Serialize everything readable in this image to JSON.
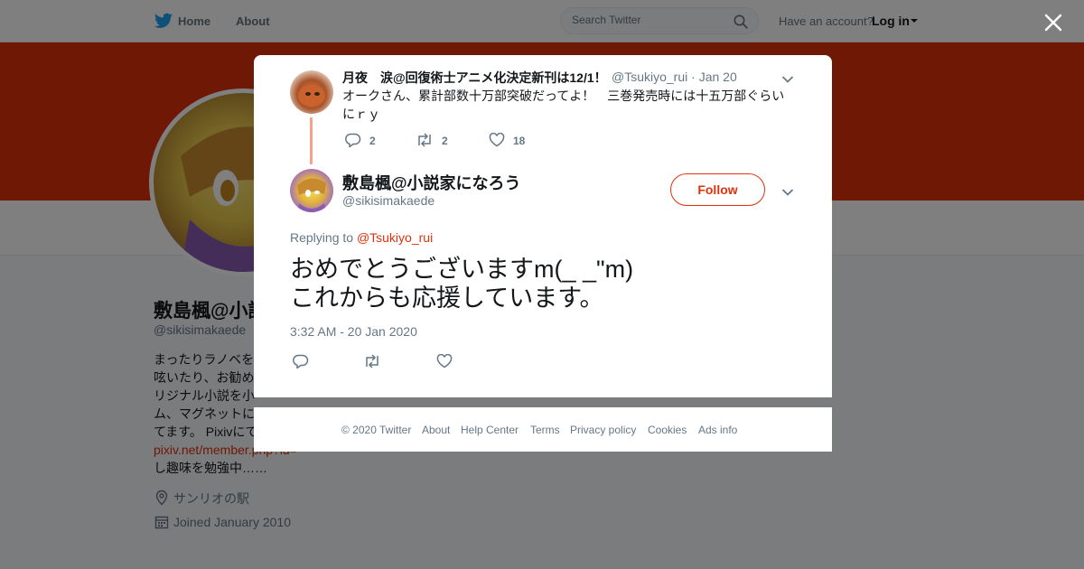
{
  "nav": {
    "home": "Home",
    "about": "About",
    "search_placeholder": "Search Twitter",
    "account_prompt": "Have an account?",
    "login": "Log in"
  },
  "profile": {
    "name": "敷島楓@小説",
    "handle": "@sikisimakaede",
    "bio_lines": [
      "まったりラノベを",
      "呟いたり、お勧め",
      "リジナル小説を小",
      "ム、マグネットに",
      "てます。 Pixivにて"
    ],
    "bio_link": "pixiv.net/member.php?id=",
    "bio_tail": "し趣味を勉強中……",
    "location": "サンリオの駅",
    "joined": "Joined January 2010"
  },
  "parent_tweet": {
    "name": "月夜　涙@回復術士アニメ化決定新刊は12/1！",
    "handle": "@Tsukiyo_rui",
    "date": "Jan 20",
    "text": "オークさん、累計部数十万部突破だってよ！　三巻発売時には十五万部ぐらいにｒｙ",
    "replies": "2",
    "retweets": "2",
    "likes": "18"
  },
  "main_tweet": {
    "name": "敷島楓@小説家になろう",
    "handle": "@sikisimakaede",
    "follow": "Follow",
    "replying_prefix": "Replying to",
    "replying_to": "@Tsukiyo_rui",
    "text_line1": "おめでとうございますm(_ _\"m)",
    "text_line2": "これからも応援しています。",
    "timestamp": "3:32 AM - 20 Jan 2020"
  },
  "footer": {
    "copyright": "© 2020 Twitter",
    "about": "About",
    "help": "Help Center",
    "terms": "Terms",
    "privacy": "Privacy policy",
    "cookies": "Cookies",
    "ads": "Ads info"
  },
  "colors": {
    "accent": "#e0310c",
    "twitter_blue": "#1da1f2",
    "muted": "#657786"
  }
}
